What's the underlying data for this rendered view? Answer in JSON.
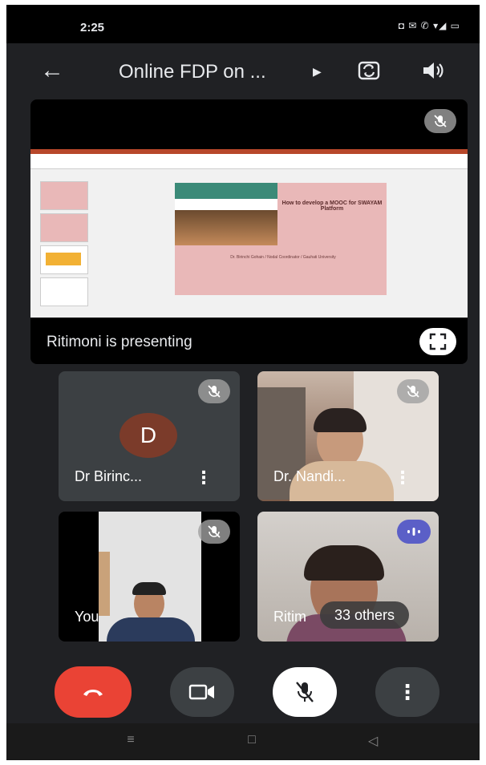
{
  "status": {
    "time": "2:25",
    "icons": "◘ ✉ ✆ ▾◢ ▭"
  },
  "appbar": {
    "title": "Online FDP on ...",
    "back_icon": "arrow-left-icon",
    "title_icon": "triangle-right-icon"
  },
  "presentation": {
    "presenter_label": "Ritimoni is presenting",
    "slide": {
      "heading": "How to develop a MOOC for SWAYAM Platform",
      "subtext": "Dr. Birinchi Gohain / Nodal Coordinator / Gauhati University"
    }
  },
  "participants": [
    {
      "name": "Dr Birinc...",
      "initial": "D",
      "avatar_color": "#7b3b2a",
      "muted": true
    },
    {
      "name": "Dr. Nandi...",
      "muted": true
    },
    {
      "name": "You",
      "muted": true
    },
    {
      "name": "Ritim",
      "speaking": true,
      "others_label": "33 others"
    }
  ],
  "controls": {
    "end_call_color": "#ea4335",
    "items": [
      "end-call",
      "camera",
      "microphone",
      "more-options"
    ]
  },
  "colors": {
    "background": "#202124",
    "accent_speaking": "#5b5fc7"
  }
}
